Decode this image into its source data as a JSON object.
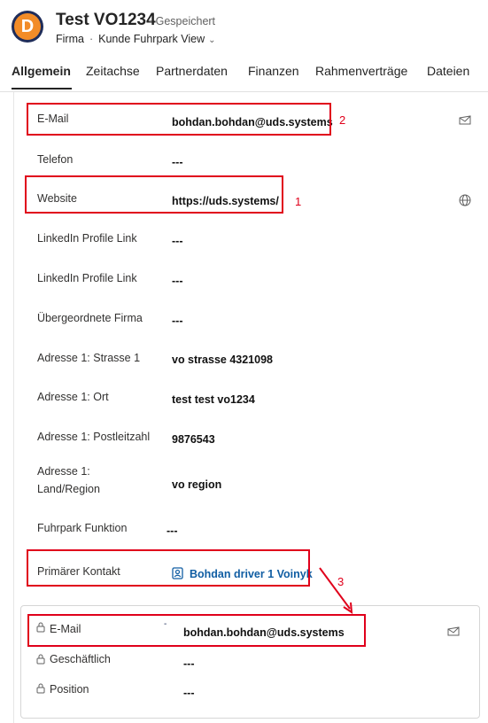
{
  "header": {
    "logo_letter": "D",
    "title": "Test VO1234",
    "saved_status": "- Gespeichert",
    "entity_type": "Firma",
    "view_name": "Kunde Fuhrpark View"
  },
  "tabs": [
    "Allgemein",
    "Zeitachse",
    "Partnerdaten",
    "Finanzen",
    "Rahmenverträge",
    "Dateien"
  ],
  "active_tab": "Allgemein",
  "fields": [
    {
      "label": "E-Mail",
      "value": "bohdan.bohdan@uds.systems",
      "icon": "mail-icon"
    },
    {
      "label": "Telefon",
      "value": "---"
    },
    {
      "label": "Website",
      "value": "https://uds.systems/",
      "icon": "globe-icon"
    },
    {
      "label": "LinkedIn Profile Link",
      "value": "---"
    },
    {
      "label": "LinkedIn Profile Link",
      "value": "---"
    },
    {
      "label": "Übergeordnete Firma",
      "value": "---"
    },
    {
      "label": "Adresse 1: Strasse 1",
      "value": "vo strasse 4321098"
    },
    {
      "label": "Adresse 1: Ort",
      "value": "test test vo1234"
    },
    {
      "label": "Adresse 1: Postleitzahl",
      "value": "9876543"
    },
    {
      "label": "Adresse 1: Land/Region",
      "value": "vo region"
    },
    {
      "label": "Fuhrpark Funktion",
      "value": "---"
    },
    {
      "label": "Primärer Kontakt",
      "value": "Bohdan driver 1 Voinyk",
      "icon": "contact-icon"
    }
  ],
  "related_contact": [
    {
      "label": "E-Mail",
      "value": "bohdan.bohdan@uds.systems",
      "icon": "mail-icon"
    },
    {
      "label": "Geschäftlich",
      "value": "---"
    },
    {
      "label": "Position",
      "value": "---"
    }
  ],
  "annotations": {
    "n1": "1",
    "n2": "2",
    "n3": "3",
    "stray_mark": "-"
  },
  "colors": {
    "annotation_red": "#e0001b",
    "link_blue": "#115ea3",
    "logo_orange": "#f28c28",
    "logo_navy": "#1f2d5a"
  }
}
